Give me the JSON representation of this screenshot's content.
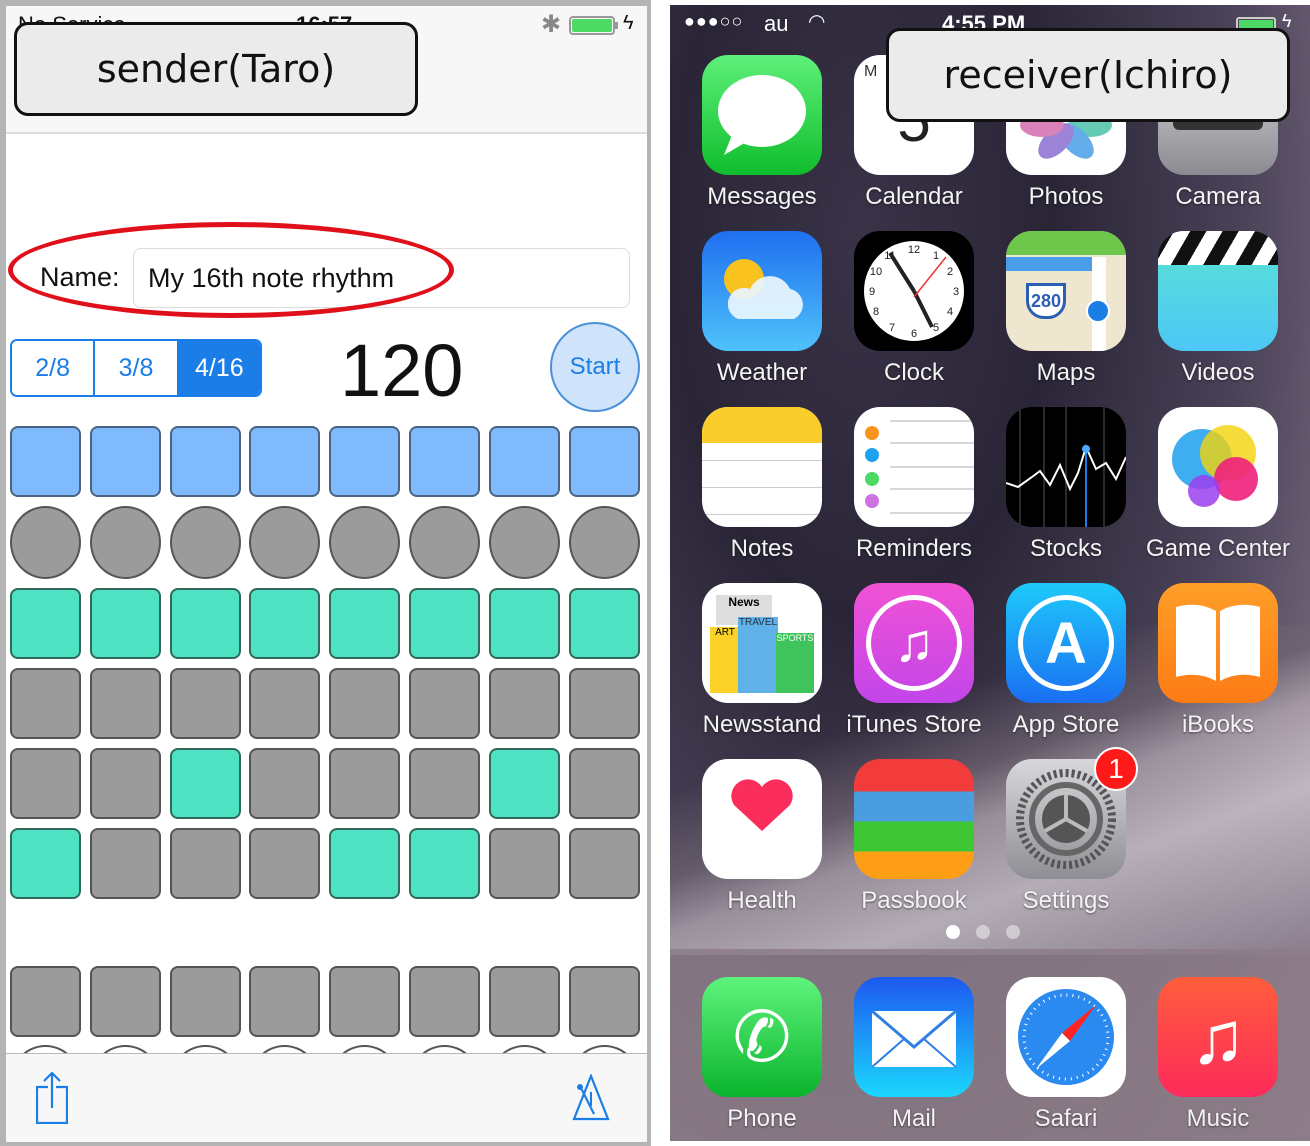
{
  "annotations": {
    "sender_label": "sender(Taro)",
    "receiver_label": "receiver(Ichiro)",
    "highlight_color": "#e0101a"
  },
  "sender": {
    "status_bar": {
      "carrier": "No Service",
      "time": "16:57",
      "battery_percent": 100
    },
    "name_label": "Name:",
    "name_value": "My 16th note rhythm",
    "time_signatures": [
      {
        "label": "2/8",
        "selected": false
      },
      {
        "label": "3/8",
        "selected": false
      },
      {
        "label": "4/16",
        "selected": true
      }
    ],
    "tempo": "120",
    "start_label": "Start",
    "grid_rows": [
      {
        "shape": "square",
        "states": [
          "blue",
          "blue",
          "blue",
          "blue",
          "blue",
          "blue",
          "blue",
          "blue"
        ]
      },
      {
        "shape": "circle",
        "states": [
          "off",
          "off",
          "off",
          "off",
          "off",
          "off",
          "off",
          "off"
        ]
      },
      {
        "shape": "square",
        "states": [
          "on",
          "on",
          "on",
          "on",
          "on",
          "on",
          "on",
          "on"
        ]
      },
      {
        "shape": "square",
        "states": [
          "off",
          "off",
          "off",
          "off",
          "off",
          "off",
          "off",
          "off"
        ]
      },
      {
        "shape": "square",
        "states": [
          "off",
          "off",
          "on",
          "off",
          "off",
          "off",
          "on",
          "off"
        ]
      },
      {
        "shape": "square",
        "states": [
          "on",
          "off",
          "off",
          "off",
          "on",
          "on",
          "off",
          "off"
        ]
      }
    ],
    "lower_grid_rows": [
      {
        "shape": "square",
        "states": [
          "off",
          "off",
          "off",
          "off",
          "off",
          "off",
          "off",
          "off"
        ]
      },
      {
        "shape": "outline-circle",
        "states": [
          "off",
          "off",
          "off",
          "off",
          "off",
          "off",
          "off",
          "off"
        ]
      }
    ],
    "toolbar": {
      "left_icon": "share-icon",
      "right_icon": "metronome-icon"
    },
    "colors": {
      "accent": "#1a7ee6",
      "step_on": "#4fe2c2",
      "step_off": "#9b9b9b",
      "beat": "#7fbbfc"
    }
  },
  "receiver": {
    "status_bar": {
      "signal": "●●●○○",
      "carrier": "au",
      "time": "4:55 PM"
    },
    "apps": [
      {
        "name": "Messages",
        "icon": "messages-icon"
      },
      {
        "name": "Calendar",
        "icon": "calendar-icon"
      },
      {
        "name": "Photos",
        "icon": "photos-icon"
      },
      {
        "name": "Camera",
        "icon": "camera-icon"
      },
      {
        "name": "Weather",
        "icon": "weather-icon"
      },
      {
        "name": "Clock",
        "icon": "clock-icon"
      },
      {
        "name": "Maps",
        "icon": "maps-icon",
        "shield": "280"
      },
      {
        "name": "Videos",
        "icon": "videos-icon"
      },
      {
        "name": "Notes",
        "icon": "notes-icon"
      },
      {
        "name": "Reminders",
        "icon": "reminders-icon"
      },
      {
        "name": "Stocks",
        "icon": "stocks-icon"
      },
      {
        "name": "Game Center",
        "icon": "game-center-icon"
      },
      {
        "name": "Newsstand",
        "icon": "newsstand-icon"
      },
      {
        "name": "iTunes Store",
        "icon": "itunes-store-icon"
      },
      {
        "name": "App Store",
        "icon": "app-store-icon"
      },
      {
        "name": "iBooks",
        "icon": "ibooks-icon"
      },
      {
        "name": "Health",
        "icon": "health-icon"
      },
      {
        "name": "Passbook",
        "icon": "passbook-icon"
      },
      {
        "name": "Settings",
        "icon": "settings-icon",
        "badge": "1"
      }
    ],
    "page_indicator": {
      "count": 3,
      "current": 1
    },
    "dock": [
      {
        "name": "Phone",
        "icon": "phone-icon"
      },
      {
        "name": "Mail",
        "icon": "mail-icon"
      },
      {
        "name": "Safari",
        "icon": "safari-icon"
      },
      {
        "name": "Music",
        "icon": "music-icon"
      }
    ]
  }
}
